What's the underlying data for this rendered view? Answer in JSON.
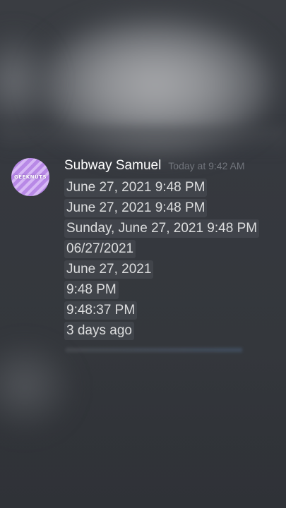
{
  "message": {
    "avatar_text": "GEEKNUTS",
    "username": "Subway Samuel",
    "timestamp": "Today at 9:42 AM",
    "lines": [
      "June 27, 2021 9:48 PM",
      "June 27, 2021 9:48 PM",
      "Sunday, June 27, 2021 9:48 PM",
      "06/27/2021",
      "June 27, 2021",
      "9:48 PM",
      "9:48:37 PM",
      "3 days ago"
    ]
  },
  "colors": {
    "background": "#36393f",
    "username": "#ffffff",
    "timestamp": "#72767d",
    "message_text": "#dcddde",
    "timestamp_chip": "#4f545c",
    "avatar": "#b889e6"
  }
}
